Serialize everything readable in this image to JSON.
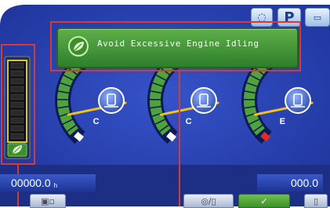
{
  "message": {
    "text": "Avoid Excessive Engine Idling"
  },
  "tabs": {
    "p_label": "P"
  },
  "gauges": [
    {
      "id": "engine-coolant",
      "icon": "coolant-temp-icon",
      "end_label": "C"
    },
    {
      "id": "hydraulic-oil",
      "icon": "hydraulic-oil-temp-icon",
      "end_label": "C"
    },
    {
      "id": "fuel",
      "icon": "fuel-pump-icon",
      "end_label": "E"
    }
  ],
  "eco_gauge": {
    "segments_lit": 0,
    "segments_total": 10,
    "icon": "leaf-icon"
  },
  "status": {
    "hour_meter": "00000.0",
    "hour_unit": "h",
    "right_value": "000.0"
  },
  "softkeys": [
    {
      "icon": "camera-mode-icon"
    },
    {
      "label": "◎/▯",
      "icon": "ac-mode-icon"
    },
    {
      "label": "✓",
      "icon": "check-icon"
    },
    {
      "icon": "menu-icon"
    }
  ],
  "colors": {
    "screen_bg": "#2b46b7",
    "accent_green": "#4fa33b",
    "highlight_red": "#d63a34",
    "needle": "#f2c21b"
  }
}
